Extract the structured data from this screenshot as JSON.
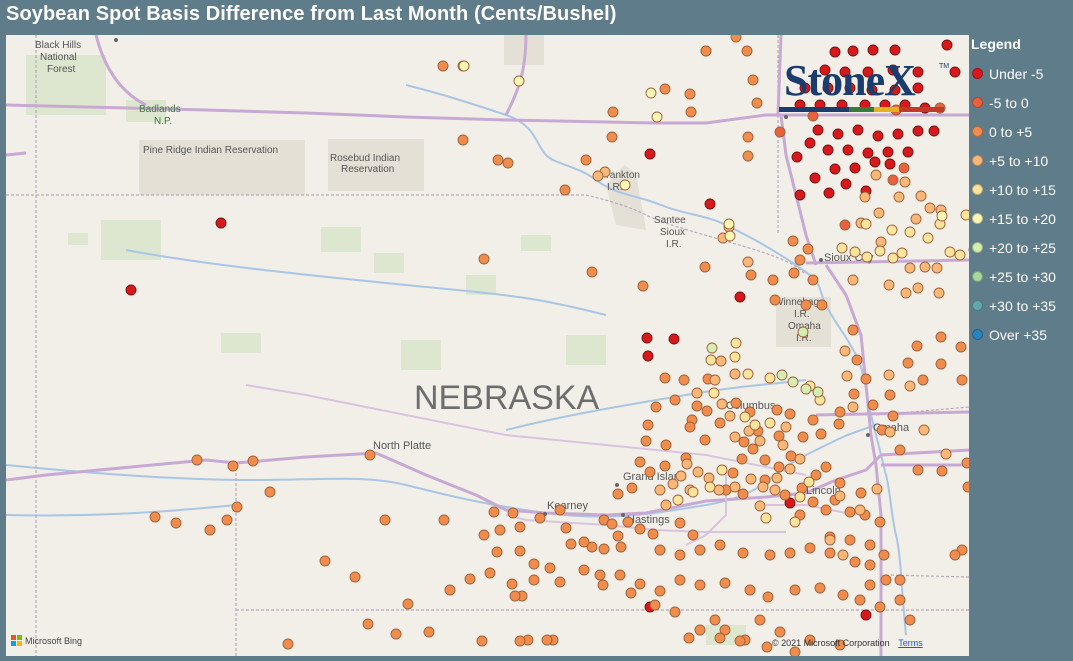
{
  "title": "Soybean Spot Basis Difference from Last Month (Cents/Bushel)",
  "legend": {
    "title": "Legend",
    "items": [
      {
        "label": "Under -5",
        "color": "#d7191c"
      },
      {
        "label": "-5 to 0",
        "color": "#e8603c"
      },
      {
        "label": "0 to +5",
        "color": "#f08c4c"
      },
      {
        "label": "+5 to +10",
        "color": "#f9b878"
      },
      {
        "label": "+10 to +15",
        "color": "#fde49c"
      },
      {
        "label": "+15 to +20",
        "color": "#fdf7b5"
      },
      {
        "label": "+20 to +25",
        "color": "#d3eeb0"
      },
      {
        "label": "+25 to +30",
        "color": "#a5d79f"
      },
      {
        "label": "+30 to +35",
        "color": "#62a8ad"
      },
      {
        "label": "Over +35",
        "color": "#2b83ba"
      }
    ]
  },
  "map_labels": {
    "state": "NEBRASKA",
    "black_hills": "Black Hills",
    "black_hills_2": "National",
    "black_hills_3": "Forest",
    "badlands": "Badlands",
    "badlands_2": "N.P.",
    "pine_ridge": "Pine Ridge Indian Reservation",
    "rosebud": "Rosebud Indian",
    "rosebud_2": "Reservation",
    "yankton": "Yankton",
    "yankton_2": "I.R.",
    "santee": "Santee",
    "santee_2": "Sioux",
    "santee_3": "I.R.",
    "sioux_city": "Sioux City",
    "winnebago": "Winnebago",
    "winnebago_2": "I.R.",
    "omaha_ir": "Omaha",
    "omaha_ir_2": "I.R.",
    "columbus": "Columbus",
    "omaha": "Omaha",
    "north_platte": "North Platte",
    "grand_island": "Grand Island",
    "kearney": "Kearney",
    "hastings": "Hastings",
    "lincoln": "Lincoln"
  },
  "brand": {
    "logo": "StoneX",
    "tm": "TM"
  },
  "attribution": {
    "bing": "Microsoft Bing",
    "copyright": "© 2021 Microsoft Corporation",
    "terms": "Terms"
  },
  "points_by_category": [
    [
      [
        221,
        223
      ],
      [
        131,
        290
      ],
      [
        650,
        154
      ],
      [
        710,
        204
      ],
      [
        740,
        297
      ],
      [
        647,
        338
      ],
      [
        674,
        339
      ],
      [
        648,
        356
      ],
      [
        866,
        615
      ],
      [
        650,
        607
      ],
      [
        790,
        503
      ],
      [
        835,
        52
      ],
      [
        853,
        51
      ],
      [
        873,
        50
      ],
      [
        895,
        50
      ],
      [
        947,
        45
      ],
      [
        955,
        72
      ],
      [
        825,
        70
      ],
      [
        845,
        72
      ],
      [
        868,
        72
      ],
      [
        893,
        70
      ],
      [
        918,
        72
      ],
      [
        805,
        88
      ],
      [
        828,
        88
      ],
      [
        850,
        88
      ],
      [
        872,
        90
      ],
      [
        895,
        90
      ],
      [
        918,
        88
      ],
      [
        800,
        105
      ],
      [
        820,
        105
      ],
      [
        842,
        105
      ],
      [
        865,
        105
      ],
      [
        885,
        105
      ],
      [
        905,
        105
      ],
      [
        925,
        108
      ],
      [
        818,
        130
      ],
      [
        838,
        134
      ],
      [
        858,
        130
      ],
      [
        878,
        136
      ],
      [
        898,
        134
      ],
      [
        918,
        131
      ],
      [
        934,
        131
      ],
      [
        828,
        150
      ],
      [
        848,
        150
      ],
      [
        868,
        153
      ],
      [
        888,
        152
      ],
      [
        908,
        152
      ],
      [
        835,
        169
      ],
      [
        855,
        168
      ],
      [
        875,
        162
      ],
      [
        890,
        164
      ],
      [
        815,
        178
      ],
      [
        846,
        184
      ],
      [
        800,
        195
      ],
      [
        829,
        193
      ],
      [
        866,
        191
      ],
      [
        797,
        157
      ],
      [
        810,
        143
      ]
    ],
    [
      [
        845,
        225
      ],
      [
        780,
        132
      ],
      [
        813,
        116
      ],
      [
        893,
        180
      ],
      [
        904,
        168
      ],
      [
        940,
        108
      ],
      [
        896,
        110
      ]
    ],
    [
      [
        736,
        37
      ],
      [
        706,
        51
      ],
      [
        747,
        51
      ],
      [
        757,
        103
      ],
      [
        753,
        80
      ],
      [
        690,
        94
      ],
      [
        691,
        112
      ],
      [
        665,
        89
      ],
      [
        748,
        137
      ],
      [
        748,
        156
      ],
      [
        793,
        241
      ],
      [
        808,
        249
      ],
      [
        800,
        260
      ],
      [
        813,
        280
      ],
      [
        794,
        273
      ],
      [
        806,
        305
      ],
      [
        822,
        305
      ],
      [
        853,
        330
      ],
      [
        857,
        360
      ],
      [
        866,
        379
      ],
      [
        854,
        394
      ],
      [
        873,
        405
      ],
      [
        882,
        430
      ],
      [
        941,
        337
      ],
      [
        961,
        347
      ],
      [
        975,
        346
      ],
      [
        962,
        380
      ],
      [
        890,
        395
      ],
      [
        893,
        416
      ],
      [
        908,
        363
      ],
      [
        917,
        346
      ],
      [
        923,
        380
      ],
      [
        941,
        364
      ],
      [
        900,
        450
      ],
      [
        918,
        470
      ],
      [
        942,
        471
      ],
      [
        967,
        463
      ],
      [
        968,
        487
      ],
      [
        962,
        550
      ],
      [
        955,
        555
      ],
      [
        886,
        580
      ],
      [
        870,
        585
      ],
      [
        884,
        555
      ],
      [
        870,
        545
      ],
      [
        900,
        580
      ],
      [
        826,
        510
      ],
      [
        800,
        515
      ],
      [
        813,
        502
      ],
      [
        835,
        500
      ],
      [
        850,
        512
      ],
      [
        865,
        515
      ],
      [
        880,
        522
      ],
      [
        861,
        493
      ],
      [
        840,
        483
      ],
      [
        816,
        475
      ],
      [
        802,
        488
      ],
      [
        785,
        495
      ],
      [
        765,
        480
      ],
      [
        743,
        494
      ],
      [
        726,
        490
      ],
      [
        733,
        473
      ],
      [
        742,
        459
      ],
      [
        753,
        449
      ],
      [
        765,
        460
      ],
      [
        779,
        467
      ],
      [
        791,
        456
      ],
      [
        803,
        437
      ],
      [
        813,
        420
      ],
      [
        821,
        434
      ],
      [
        839,
        424
      ],
      [
        840,
        412
      ],
      [
        826,
        467
      ],
      [
        744,
        442
      ],
      [
        758,
        431
      ],
      [
        779,
        436
      ],
      [
        790,
        414
      ],
      [
        777,
        410
      ],
      [
        750,
        412
      ],
      [
        736,
        403
      ],
      [
        707,
        411
      ],
      [
        692,
        420
      ],
      [
        697,
        406
      ],
      [
        675,
        400
      ],
      [
        656,
        407
      ],
      [
        684,
        380
      ],
      [
        708,
        379
      ],
      [
        665,
        378
      ],
      [
        646,
        441
      ],
      [
        666,
        445
      ],
      [
        648,
        425
      ],
      [
        690,
        427
      ],
      [
        720,
        423
      ],
      [
        705,
        440
      ],
      [
        686,
        458
      ],
      [
        665,
        466
      ],
      [
        650,
        472
      ],
      [
        640,
        462
      ],
      [
        632,
        488
      ],
      [
        618,
        494
      ],
      [
        628,
        522
      ],
      [
        618,
        536
      ],
      [
        604,
        520
      ],
      [
        592,
        547
      ],
      [
        584,
        570
      ],
      [
        584,
        542
      ],
      [
        571,
        544
      ],
      [
        566,
        528
      ],
      [
        560,
        510
      ],
      [
        540,
        518
      ],
      [
        520,
        527
      ],
      [
        500,
        530
      ],
      [
        484,
        535
      ],
      [
        497,
        552
      ],
      [
        520,
        551
      ],
      [
        534,
        564
      ],
      [
        550,
        568
      ],
      [
        560,
        582
      ],
      [
        534,
        580
      ],
      [
        522,
        596
      ],
      [
        512,
        584
      ],
      [
        490,
        573
      ],
      [
        470,
        579
      ],
      [
        450,
        590
      ],
      [
        444,
        520
      ],
      [
        385,
        520
      ],
      [
        325,
        561
      ],
      [
        270,
        492
      ],
      [
        237,
        507
      ],
      [
        227,
        520
      ],
      [
        210,
        530
      ],
      [
        176,
        523
      ],
      [
        155,
        517
      ],
      [
        197,
        460
      ],
      [
        233,
        466
      ],
      [
        253,
        461
      ],
      [
        370,
        455
      ],
      [
        513,
        513
      ],
      [
        494,
        512
      ],
      [
        600,
        575
      ],
      [
        620,
        575
      ],
      [
        640,
        584
      ],
      [
        660,
        591
      ],
      [
        680,
        580
      ],
      [
        700,
        585
      ],
      [
        725,
        583
      ],
      [
        750,
        590
      ],
      [
        768,
        597
      ],
      [
        795,
        590
      ],
      [
        820,
        588
      ],
      [
        843,
        595
      ],
      [
        860,
        600
      ],
      [
        880,
        607
      ],
      [
        900,
        600
      ],
      [
        910,
        620
      ],
      [
        700,
        630
      ],
      [
        715,
        620
      ],
      [
        725,
        630
      ],
      [
        745,
        640
      ],
      [
        767,
        647
      ],
      [
        780,
        632
      ],
      [
        795,
        652
      ],
      [
        810,
        640
      ],
      [
        840,
        645
      ],
      [
        660,
        550
      ],
      [
        680,
        555
      ],
      [
        700,
        550
      ],
      [
        720,
        545
      ],
      [
        743,
        553
      ],
      [
        770,
        555
      ],
      [
        790,
        553
      ],
      [
        810,
        548
      ],
      [
        830,
        537
      ],
      [
        850,
        540
      ],
      [
        830,
        553
      ],
      [
        855,
        562
      ],
      [
        870,
        565
      ],
      [
        680,
        523
      ],
      [
        693,
        535
      ],
      [
        653,
        534
      ],
      [
        640,
        529
      ],
      [
        612,
        524
      ],
      [
        621,
        547
      ],
      [
        604,
        549
      ],
      [
        603,
        585
      ],
      [
        631,
        593
      ],
      [
        655,
        605
      ],
      [
        675,
        612
      ],
      [
        689,
        638
      ],
      [
        720,
        638
      ],
      [
        740,
        641
      ],
      [
        760,
        620
      ],
      [
        553,
        640
      ],
      [
        547,
        640
      ],
      [
        528,
        640
      ],
      [
        520,
        641
      ],
      [
        482,
        641
      ],
      [
        429,
        632
      ],
      [
        396,
        634
      ],
      [
        368,
        624
      ],
      [
        408,
        604
      ],
      [
        288,
        644
      ],
      [
        515,
        596
      ],
      [
        355,
        577
      ],
      [
        484,
        259
      ],
      [
        592,
        272
      ],
      [
        643,
        286
      ],
      [
        705,
        267
      ],
      [
        751,
        275
      ],
      [
        773,
        280
      ],
      [
        775,
        300
      ],
      [
        612,
        137
      ],
      [
        613,
        112
      ],
      [
        586,
        160
      ],
      [
        565,
        190
      ],
      [
        498,
        160
      ],
      [
        508,
        163
      ],
      [
        463,
        140
      ],
      [
        443,
        66
      ],
      [
        706,
        51
      ]
    ],
    [
      [
        463,
        66
      ],
      [
        605,
        172
      ],
      [
        598,
        176
      ],
      [
        723,
        238
      ],
      [
        729,
        227
      ],
      [
        748,
        262
      ],
      [
        876,
        175
      ],
      [
        905,
        182
      ],
      [
        881,
        242
      ],
      [
        899,
        197
      ],
      [
        916,
        219
      ],
      [
        921,
        196
      ],
      [
        930,
        208
      ],
      [
        941,
        210
      ],
      [
        910,
        268
      ],
      [
        925,
        267
      ],
      [
        937,
        268
      ],
      [
        865,
        197
      ],
      [
        879,
        213
      ],
      [
        861,
        223
      ],
      [
        889,
        285
      ],
      [
        918,
        288
      ],
      [
        939,
        293
      ],
      [
        906,
        293
      ],
      [
        853,
        280
      ],
      [
        889,
        375
      ],
      [
        910,
        386
      ],
      [
        845,
        351
      ],
      [
        847,
        376
      ],
      [
        853,
        407
      ],
      [
        721,
        361
      ],
      [
        735,
        374
      ],
      [
        715,
        380
      ],
      [
        697,
        393
      ],
      [
        722,
        404
      ],
      [
        730,
        416
      ],
      [
        735,
        437
      ],
      [
        749,
        431
      ],
      [
        760,
        441
      ],
      [
        786,
        427
      ],
      [
        783,
        445
      ],
      [
        800,
        459
      ],
      [
        790,
        469
      ],
      [
        777,
        478
      ],
      [
        763,
        487
      ],
      [
        751,
        479
      ],
      [
        735,
        487
      ],
      [
        719,
        490
      ],
      [
        709,
        478
      ],
      [
        698,
        472
      ],
      [
        687,
        464
      ],
      [
        681,
        476
      ],
      [
        673,
        484
      ],
      [
        660,
        490
      ],
      [
        666,
        505
      ],
      [
        690,
        490
      ],
      [
        760,
        506
      ],
      [
        775,
        490
      ],
      [
        840,
        496
      ],
      [
        877,
        489
      ],
      [
        830,
        540
      ],
      [
        843,
        555
      ],
      [
        860,
        510
      ],
      [
        890,
        432
      ],
      [
        924,
        430
      ],
      [
        946,
        454
      ]
    ],
    [
      [
        736,
        343
      ],
      [
        748,
        374
      ],
      [
        770,
        378
      ],
      [
        810,
        386
      ],
      [
        820,
        400
      ],
      [
        842,
        248
      ],
      [
        866,
        224
      ],
      [
        892,
        230
      ],
      [
        910,
        232
      ],
      [
        928,
        238
      ],
      [
        940,
        224
      ],
      [
        950,
        252
      ],
      [
        960,
        255
      ],
      [
        974,
        250
      ],
      [
        966,
        215
      ],
      [
        855,
        252
      ],
      [
        867,
        257
      ],
      [
        880,
        251
      ],
      [
        893,
        258
      ],
      [
        902,
        253
      ],
      [
        711,
        360
      ],
      [
        735,
        357
      ],
      [
        714,
        393
      ],
      [
        745,
        417
      ],
      [
        755,
        425
      ],
      [
        770,
        423
      ],
      [
        722,
        470
      ],
      [
        710,
        487
      ],
      [
        693,
        492
      ],
      [
        678,
        500
      ],
      [
        766,
        518
      ],
      [
        795,
        522
      ],
      [
        800,
        497
      ],
      [
        809,
        482
      ]
    ],
    [
      [
        464,
        66
      ],
      [
        519,
        81
      ],
      [
        651,
        93
      ],
      [
        657,
        117
      ],
      [
        625,
        185
      ],
      [
        729,
        224
      ],
      [
        730,
        236
      ],
      [
        942,
        216
      ]
    ],
    [
      [
        803,
        332
      ],
      [
        782,
        375
      ],
      [
        793,
        382
      ],
      [
        806,
        389
      ],
      [
        818,
        392
      ],
      [
        712,
        348
      ]
    ],
    [],
    [],
    []
  ]
}
